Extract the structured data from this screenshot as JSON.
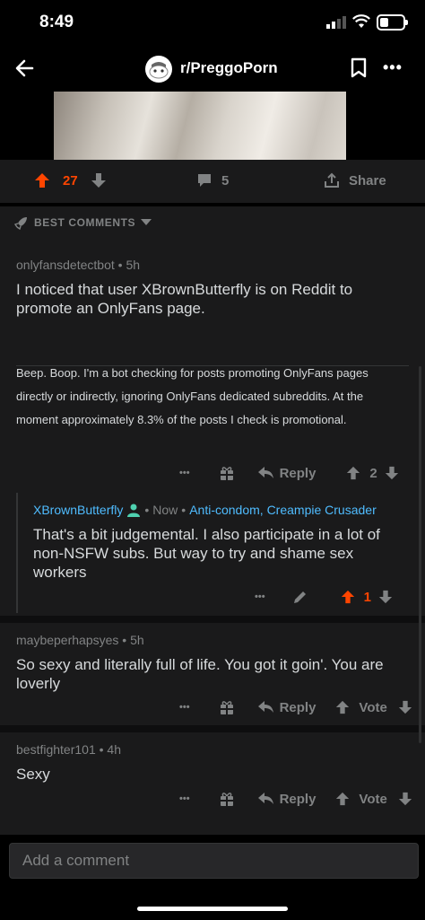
{
  "status": {
    "time": "8:49"
  },
  "header": {
    "subreddit": "r/PreggoPorn"
  },
  "post_actions": {
    "upvotes": "27",
    "comments": "5",
    "share_label": "Share"
  },
  "sort": {
    "label": "BEST COMMENTS"
  },
  "comments": [
    {
      "author": "onlyfansdetectbot",
      "age": "5h",
      "text": "I noticed that user XBrownButterfly is on Reddit to promote an OnlyFans page.",
      "bot_text": "Beep. Boop. I'm a bot checking for posts promoting OnlyFans pages directly or indirectly, ignoring OnlyFans dedicated subreddits. At the moment approximately 8.3% of the posts I check is promotional.",
      "more": "•••",
      "reply_label": "Reply",
      "score": "2"
    },
    {
      "author": "XBrownButterfly",
      "age": "Now",
      "flair": "Anti-condom, Creampie Crusader",
      "text": "That's a bit judgemental. I also participate in a lot of non-NSFW subs. But way to try and shame sex workers",
      "more": "•••",
      "score": "1"
    },
    {
      "author": "maybeperhapsyes",
      "age": "5h",
      "text": "So sexy and literally full of life.  You got it goin'.  You are loverly",
      "more": "•••",
      "reply_label": "Reply",
      "vote_label": "Vote"
    },
    {
      "author": "bestfighter101",
      "age": "4h",
      "text": "Sexy",
      "more": "•••",
      "reply_label": "Reply",
      "vote_label": "Vote"
    }
  ],
  "compose": {
    "placeholder": "Add a comment"
  },
  "colors": {
    "accent": "#ff4500",
    "flair": "#4fbcff",
    "mod": "#4fd1b0",
    "background": "#1a1a1b"
  }
}
